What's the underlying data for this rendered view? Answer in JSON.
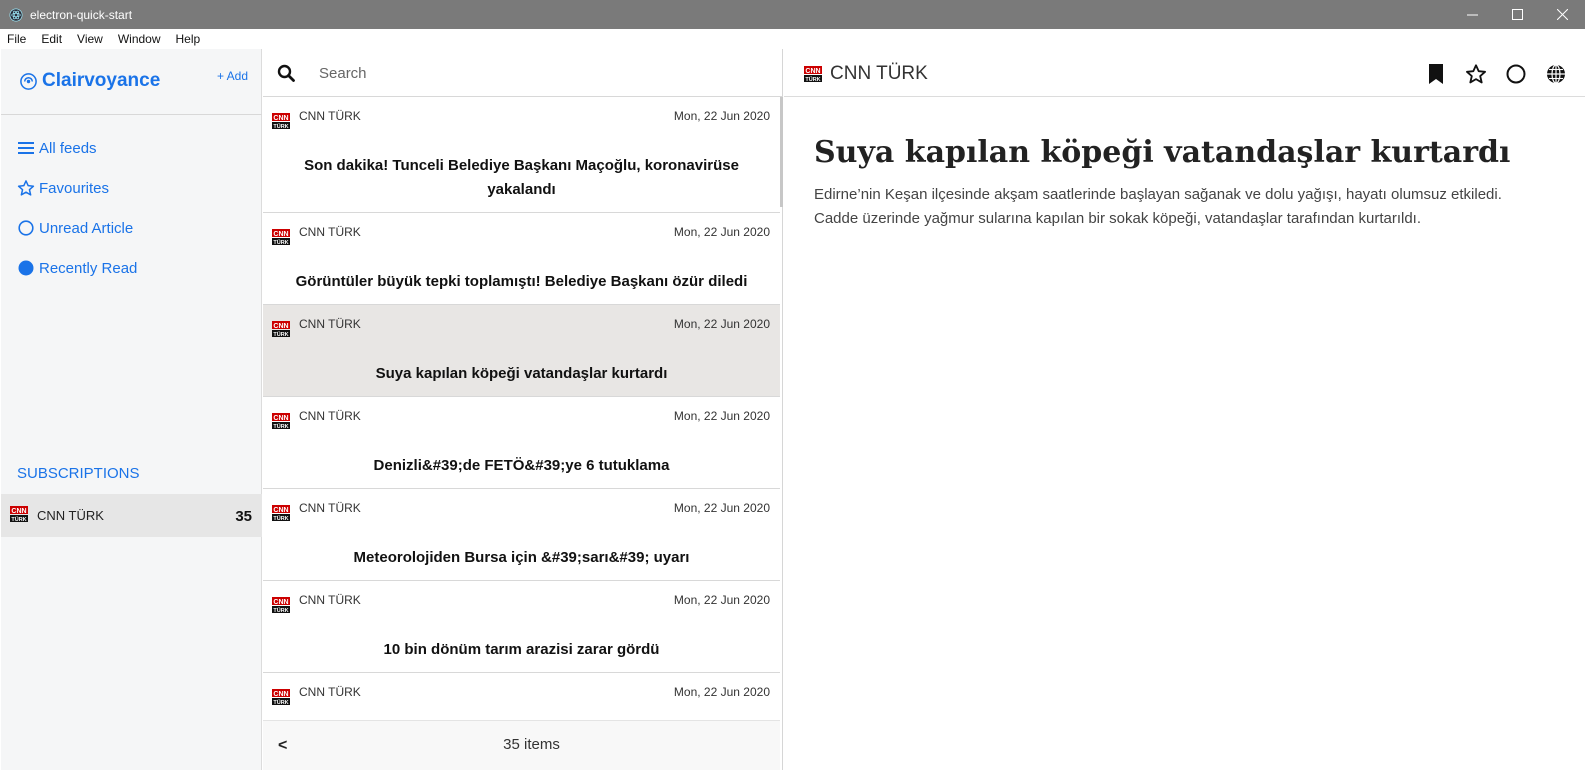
{
  "window": {
    "title": "electron-quick-start"
  },
  "menu": [
    "File",
    "Edit",
    "View",
    "Window",
    "Help"
  ],
  "sidebar": {
    "brand": "Clairvoyance",
    "add_label": "+ Add",
    "nav": [
      {
        "label": "All feeds",
        "icon": "list-icon"
      },
      {
        "label": "Favourites",
        "icon": "star-icon"
      },
      {
        "label": "Unread Article",
        "icon": "circle-outline-icon"
      },
      {
        "label": "Recently Read",
        "icon": "circle-filled-icon"
      }
    ],
    "subscriptions_header": "SUBSCRIPTIONS",
    "subscriptions": [
      {
        "name": "CNN TÜRK",
        "count": "35"
      }
    ]
  },
  "list": {
    "search_placeholder": "Search",
    "articles": [
      {
        "source": "CNN TÜRK",
        "date": "Mon, 22 Jun 2020",
        "title": "Son dakika! Tunceli Belediye Başkanı Maçoğlu, koronavirüse yakalandı"
      },
      {
        "source": "CNN TÜRK",
        "date": "Mon, 22 Jun 2020",
        "title": "Görüntüler büyük tepki toplamıştı! Belediye Başkanı özür diledi"
      },
      {
        "source": "CNN TÜRK",
        "date": "Mon, 22 Jun 2020",
        "title": "Suya kapılan köpeği vatandaşlar kurtardı"
      },
      {
        "source": "CNN TÜRK",
        "date": "Mon, 22 Jun 2020",
        "title": "Denizli&#39;de FETÖ&#39;ye 6 tutuklama"
      },
      {
        "source": "CNN TÜRK",
        "date": "Mon, 22 Jun 2020",
        "title": "Meteorolojiden Bursa için &#39;sarı&#39; uyarı"
      },
      {
        "source": "CNN TÜRK",
        "date": "Mon, 22 Jun 2020",
        "title": "10 bin dönüm tarım arazisi zarar gördü"
      },
      {
        "source": "CNN TÜRK",
        "date": "Mon, 22 Jun 2020",
        "title": ""
      }
    ],
    "footer_prev": "<",
    "footer_count": "35 items"
  },
  "reader": {
    "feed_name": "CNN TÜRK",
    "title": "Suya kapılan köpeği vatandaşlar kurtardı",
    "body": "Edirne’nin Keşan ilçesinde akşam saatlerinde başlayan sağanak ve dolu yağışı, hayatı olumsuz etkiledi. Cadde üzerinde yağmur sularına kapılan bir sokak köpeği, vatandaşlar tarafından kurtarıldı."
  },
  "colors": {
    "accent": "#1a73e8",
    "titlebar": "#7a7a7a",
    "selected_row": "#e8e6e4"
  }
}
